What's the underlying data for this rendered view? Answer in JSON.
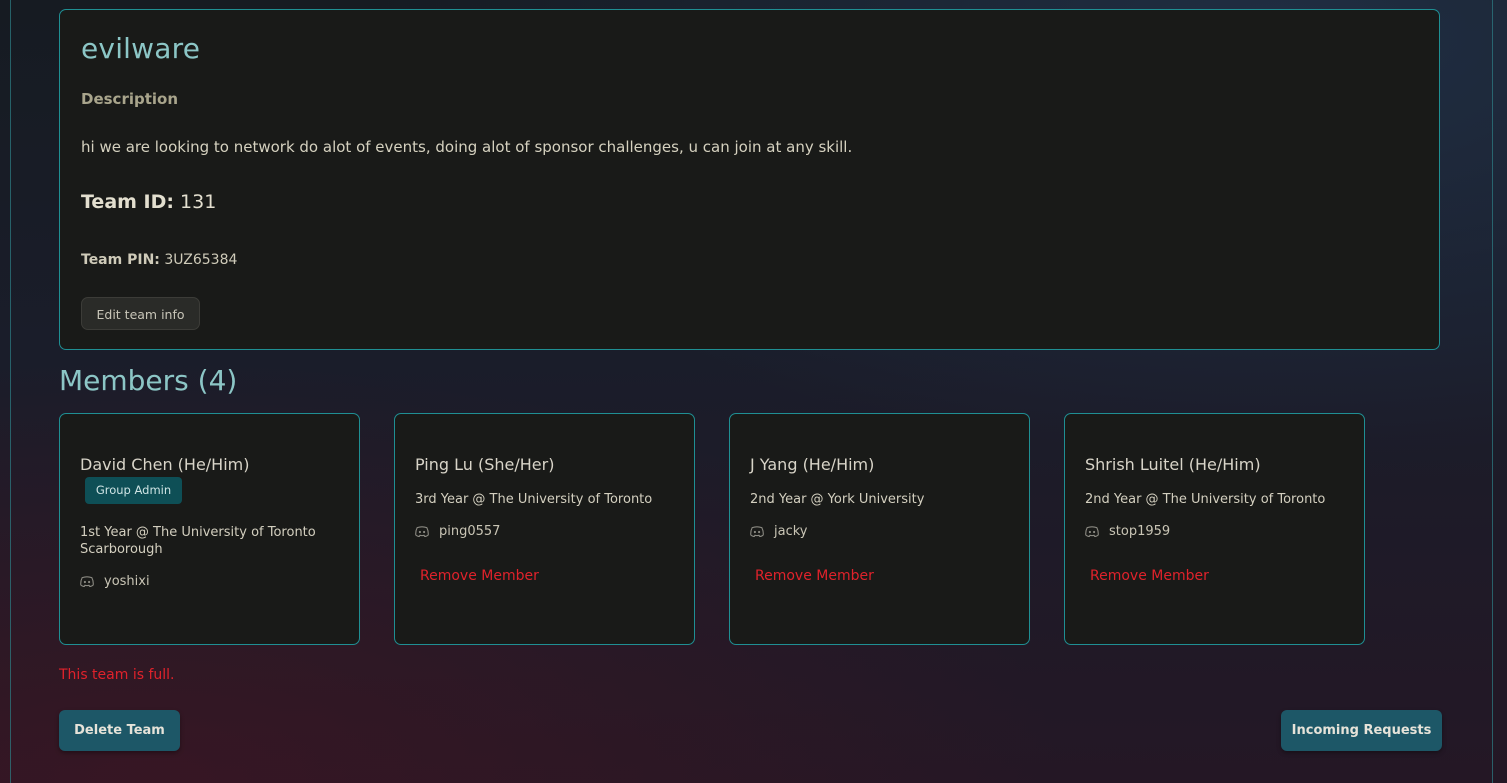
{
  "team": {
    "name": "evilware",
    "description_heading": "Description",
    "description": "hi we are looking to network do alot of events, doing alot of sponsor challenges, u can join at any skill.",
    "id_label": "Team ID:",
    "id_value": "131",
    "pin_label": "Team PIN:",
    "pin_value": "3UZ65384",
    "edit_label": "Edit team info"
  },
  "members_title": "Members (4)",
  "members": [
    {
      "name": "David Chen (He/Him)",
      "badge": "Group Admin",
      "school": "1st Year @ The University of Toronto Scarborough",
      "discord": "yoshixi"
    },
    {
      "name": "Ping Lu (She/Her)",
      "school": "3rd Year @ The University of Toronto",
      "discord": "ping0557",
      "remove_label": "Remove Member"
    },
    {
      "name": "J Yang (He/Him)",
      "school": "2nd Year @ York University",
      "discord": "jacky",
      "remove_label": "Remove Member"
    },
    {
      "name": "Shrish Luitel (He/Him)",
      "school": "2nd Year @ The University of Toronto",
      "discord": "stop1959",
      "remove_label": "Remove Member"
    }
  ],
  "status_message": "This team is full.",
  "actions": {
    "delete_label": "Delete Team",
    "requests_label": "Incoming Requests"
  },
  "colors": {
    "accent_border": "#1f8f93",
    "heading": "#8cc6c6",
    "danger": "#e0222b",
    "button": "#1d5767",
    "badge": "#0e4f56"
  }
}
